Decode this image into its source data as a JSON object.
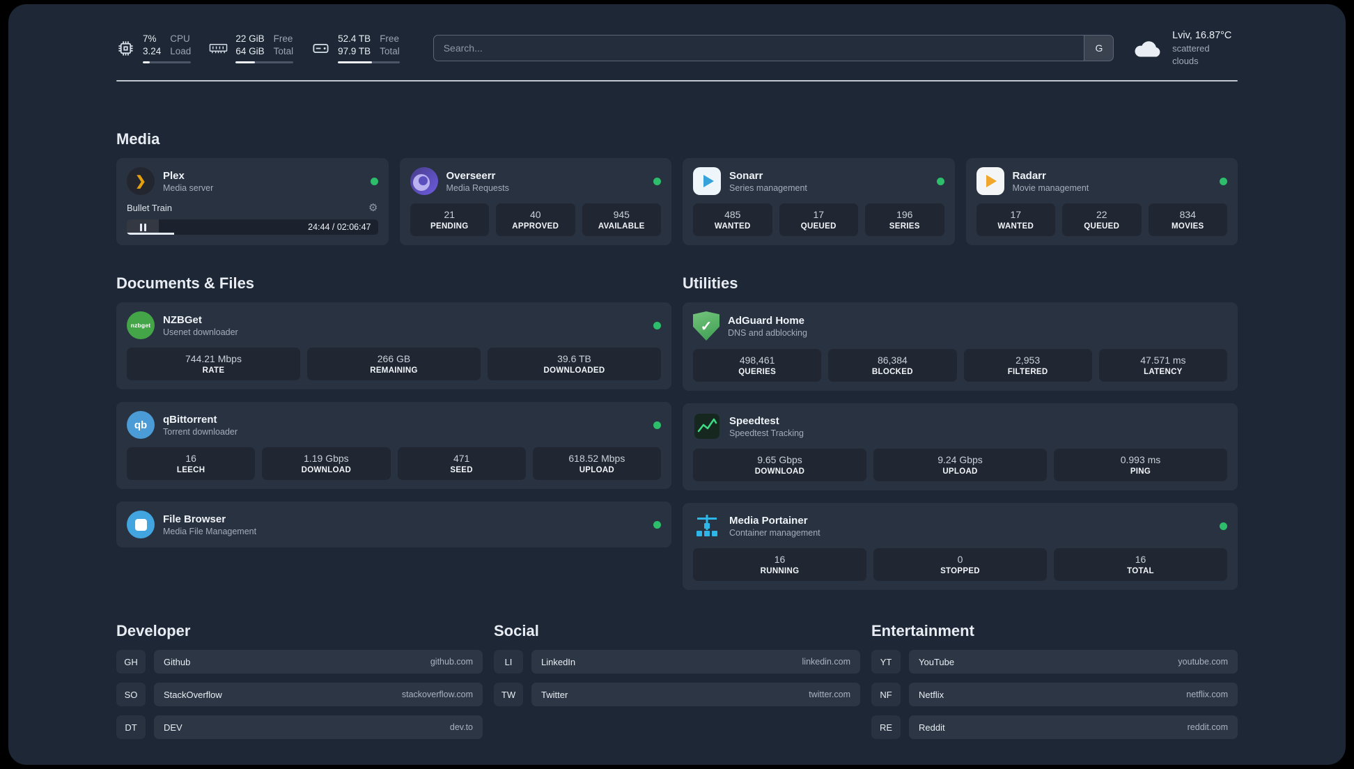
{
  "colors": {
    "bg": "#1d2736",
    "green": "#2cbe6a",
    "plex_amber": "#e5a00d",
    "sonarr_blue": "#35a3d9",
    "radarr_yellow": "#f0a72b",
    "nzbget_green": "#44a548",
    "qb_blue": "#4a9bd6",
    "filebrowser_blue": "#42a5e0",
    "adguard_green": "#3d9e53",
    "portainer_blue": "#2fb6e8"
  },
  "topbar": {
    "cpu": {
      "percent": "7%",
      "load": "3.24",
      "label1": "CPU",
      "label2": "Load",
      "bar_percent": 15
    },
    "memory": {
      "free": "22 GiB",
      "total": "64 GiB",
      "label1": "Free",
      "label2": "Total",
      "bar_percent": 34
    },
    "disk": {
      "free": "52.4 TB",
      "total": "97.9 TB",
      "label1": "Free",
      "label2": "Total",
      "bar_percent": 55
    },
    "search": {
      "placeholder": "Search...",
      "button_label": "G"
    },
    "weather": {
      "location": "Lviv, 16.87°C",
      "condition": "scattered clouds"
    }
  },
  "sections": {
    "media": {
      "heading": "Media",
      "plex": {
        "title": "Plex",
        "subtitle": "Media server",
        "track": "Bullet Train",
        "time": "24:44 / 02:06:47",
        "progress_percent": 19
      },
      "overseerr": {
        "title": "Overseerr",
        "subtitle": "Media Requests",
        "stats": [
          {
            "value": "21",
            "label": "PENDING"
          },
          {
            "value": "40",
            "label": "APPROVED"
          },
          {
            "value": "945",
            "label": "AVAILABLE"
          }
        ]
      },
      "sonarr": {
        "title": "Sonarr",
        "subtitle": "Series management",
        "stats": [
          {
            "value": "485",
            "label": "WANTED"
          },
          {
            "value": "17",
            "label": "QUEUED"
          },
          {
            "value": "196",
            "label": "SERIES"
          }
        ]
      },
      "radarr": {
        "title": "Radarr",
        "subtitle": "Movie management",
        "stats": [
          {
            "value": "17",
            "label": "WANTED"
          },
          {
            "value": "22",
            "label": "QUEUED"
          },
          {
            "value": "834",
            "label": "MOVIES"
          }
        ]
      }
    },
    "documents": {
      "heading": "Documents & Files",
      "nzbget": {
        "title": "NZBGet",
        "subtitle": "Usenet downloader",
        "icon_text": "nzbget",
        "stats": [
          {
            "value": "744.21 Mbps",
            "label": "RATE"
          },
          {
            "value": "266 GB",
            "label": "REMAINING"
          },
          {
            "value": "39.6 TB",
            "label": "DOWNLOADED"
          }
        ]
      },
      "qbittorrent": {
        "title": "qBittorrent",
        "subtitle": "Torrent downloader",
        "icon_text": "qb",
        "stats": [
          {
            "value": "16",
            "label": "LEECH"
          },
          {
            "value": "1.19 Gbps",
            "label": "DOWNLOAD"
          },
          {
            "value": "471",
            "label": "SEED"
          },
          {
            "value": "618.52 Mbps",
            "label": "UPLOAD"
          }
        ]
      },
      "filebrowser": {
        "title": "File Browser",
        "subtitle": "Media File Management"
      }
    },
    "utilities": {
      "heading": "Utilities",
      "adguard": {
        "title": "AdGuard Home",
        "subtitle": "DNS and adblocking",
        "stats": [
          {
            "value": "498,461",
            "label": "QUERIES"
          },
          {
            "value": "86,384",
            "label": "BLOCKED"
          },
          {
            "value": "2,953",
            "label": "FILTERED"
          },
          {
            "value": "47.571 ms",
            "label": "LATENCY"
          }
        ]
      },
      "speedtest": {
        "title": "Speedtest",
        "subtitle": "Speedtest Tracking",
        "stats": [
          {
            "value": "9.65 Gbps",
            "label": "DOWNLOAD"
          },
          {
            "value": "9.24 Gbps",
            "label": "UPLOAD"
          },
          {
            "value": "0.993 ms",
            "label": "PING"
          }
        ]
      },
      "portainer": {
        "title": "Media Portainer",
        "subtitle": "Container management",
        "stats": [
          {
            "value": "16",
            "label": "RUNNING"
          },
          {
            "value": "0",
            "label": "STOPPED"
          },
          {
            "value": "16",
            "label": "TOTAL"
          }
        ]
      }
    },
    "bookmarks": {
      "developer": {
        "heading": "Developer",
        "items": [
          {
            "abbr": "GH",
            "name": "Github",
            "url": "github.com"
          },
          {
            "abbr": "SO",
            "name": "StackOverflow",
            "url": "stackoverflow.com"
          },
          {
            "abbr": "DT",
            "name": "DEV",
            "url": "dev.to"
          }
        ]
      },
      "social": {
        "heading": "Social",
        "items": [
          {
            "abbr": "LI",
            "name": "LinkedIn",
            "url": "linkedin.com"
          },
          {
            "abbr": "TW",
            "name": "Twitter",
            "url": "twitter.com"
          }
        ]
      },
      "entertainment": {
        "heading": "Entertainment",
        "items": [
          {
            "abbr": "YT",
            "name": "YouTube",
            "url": "youtube.com"
          },
          {
            "abbr": "NF",
            "name": "Netflix",
            "url": "netflix.com"
          },
          {
            "abbr": "RE",
            "name": "Reddit",
            "url": "reddit.com"
          }
        ]
      }
    }
  }
}
